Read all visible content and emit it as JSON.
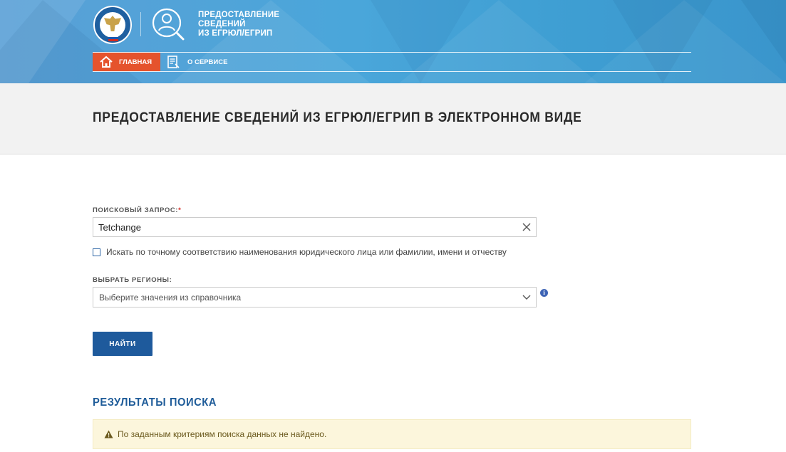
{
  "header": {
    "service_title": [
      "ПРЕДОСТАВЛЕНИЕ",
      "СВЕДЕНИЙ",
      "ИЗ ЕГРЮЛ/ЕГРИП"
    ],
    "nav": {
      "home_label": "ГЛАВНАЯ",
      "about_label": "О СЕРВИСЕ"
    }
  },
  "page": {
    "title": "ПРЕДОСТАВЛЕНИЕ СВЕДЕНИЙ ИЗ ЕГРЮЛ/ЕГРИП В ЭЛЕКТРОННОМ ВИДЕ"
  },
  "form": {
    "query_label": "ПОИСКОВЫЙ ЗАПРОС:",
    "required_mark": "*",
    "query_value": "Tetchange",
    "exact_match_label": "Искать по точному соответствию наименования юридического лица или фамилии, имени и отчеству",
    "exact_match_checked": false,
    "regions_label": "ВЫБРАТЬ РЕГИОНЫ:",
    "regions_placeholder": "Выберите значения из справочника",
    "info_glyph": "i",
    "submit_label": "НАЙТИ"
  },
  "results": {
    "title": "РЕЗУЛЬТАТЫ ПОИСКА",
    "message": "По заданным критериям поиска данных не найдено."
  },
  "colors": {
    "header_blue": "#4aa6da",
    "home_tab": "#e5532d",
    "button": "#1e5a9c",
    "results_title": "#1f5c99",
    "alert_bg": "#fcf6dc"
  },
  "icons": {
    "emblem": "fns-emblem-icon",
    "service": "service-person-icon",
    "home": "home-icon",
    "about": "document-icon",
    "clear": "close-icon",
    "dropdown": "chevron-down-icon",
    "info": "info-icon",
    "warning": "warning-icon"
  }
}
